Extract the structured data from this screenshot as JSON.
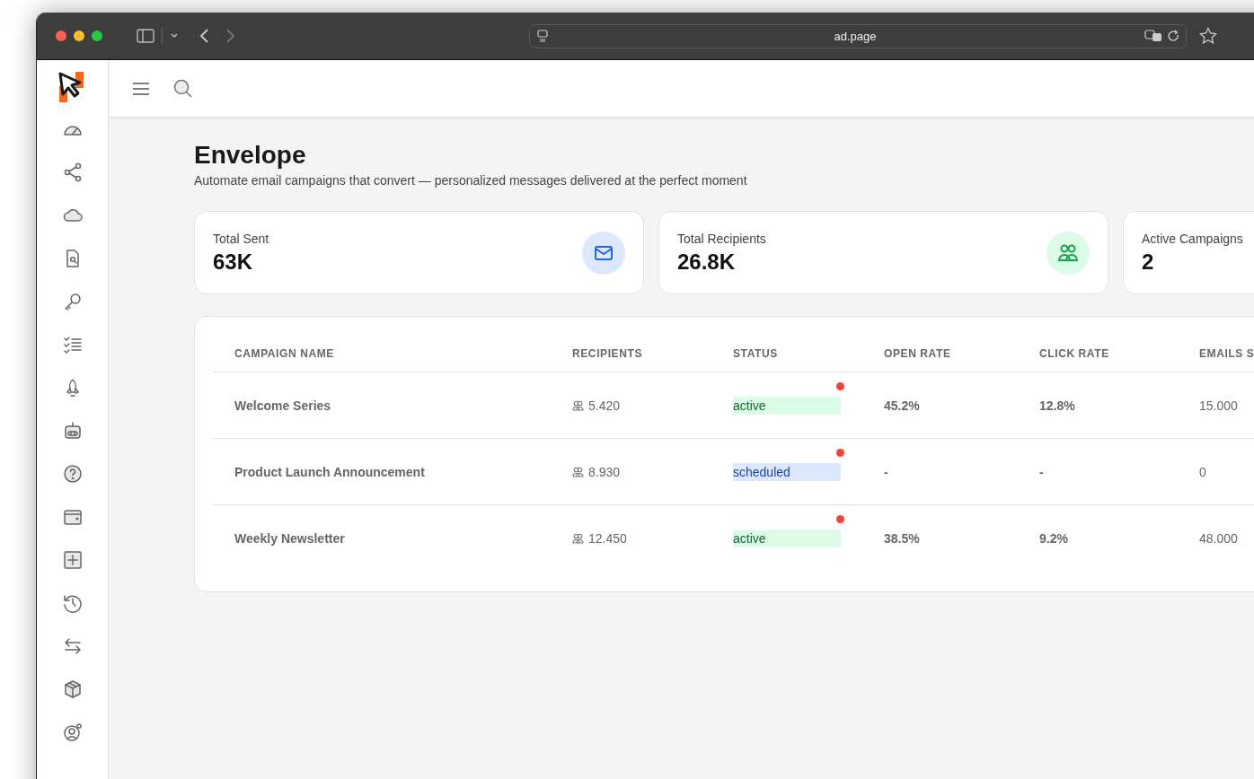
{
  "browser": {
    "url": "ad.page"
  },
  "page": {
    "title": "Envelope",
    "subtitle": "Automate email campaigns that convert — personalized messages delivered at the perfect moment"
  },
  "stats": [
    {
      "label": "Total Sent",
      "value": "63K",
      "kind": "mail"
    },
    {
      "label": "Total Recipients",
      "value": "26.8K",
      "kind": "people"
    },
    {
      "label": "Active Campaigns",
      "value": "2",
      "kind": "none"
    }
  ],
  "table": {
    "columns": [
      "CAMPAIGN NAME",
      "RECIPIENTS",
      "STATUS",
      "OPEN RATE",
      "CLICK RATE",
      "EMAILS S"
    ],
    "rows": [
      {
        "name": "Welcome Series",
        "recipients": "5.420",
        "status": "active",
        "kind": "active",
        "open_rate": "45.2%",
        "click_rate": "12.8%",
        "emails_sent": "15.000"
      },
      {
        "name": "Product Launch Announcement",
        "recipients": "8.930",
        "status": "scheduled",
        "kind": "scheduled",
        "open_rate": "-",
        "click_rate": "-",
        "emails_sent": "0"
      },
      {
        "name": "Weekly Newsletter",
        "recipients": "12.450",
        "status": "active",
        "kind": "active",
        "open_rate": "38.5%",
        "click_rate": "9.2%",
        "emails_sent": "48.000"
      }
    ]
  }
}
